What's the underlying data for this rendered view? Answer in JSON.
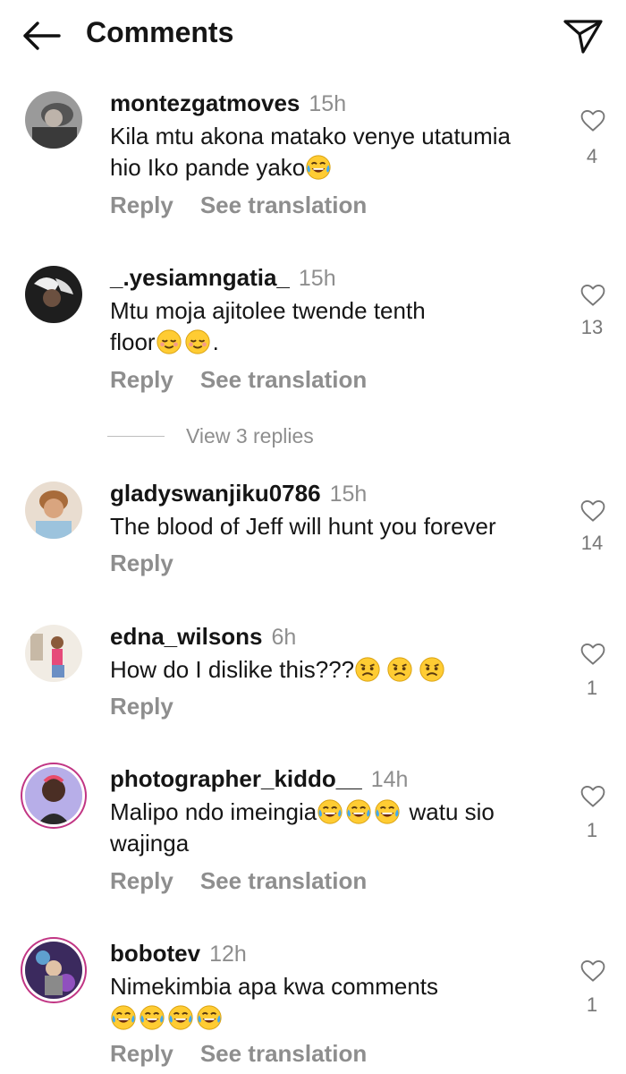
{
  "header": {
    "title": "Comments",
    "back_icon": "arrow-left-icon",
    "send_icon": "paper-plane-icon"
  },
  "actions": {
    "reply": "Reply",
    "see_translation": "See translation"
  },
  "comments": [
    {
      "username": "montezgatmoves",
      "time": "15h",
      "lines": [
        "Kila mtu akona matako venye utatumia",
        "hio Iko pande yako"
      ],
      "emoji": "tears-of-joy",
      "likes": "4",
      "avatar_color": "#6b6b6b"
    },
    {
      "username": "_.yesiamngatia_",
      "time": "15h",
      "lines": [
        "Mtu moja ajitolee twende tenth",
        "floor"
      ],
      "emoji": "relieved",
      "trailing": ".",
      "likes": "13",
      "avatar_color": "#2a2a2a"
    },
    {
      "username": "gladyswanjiku0786",
      "time": "15h",
      "lines": [
        "The blood of Jeff will hunt you forever"
      ],
      "likes": "14",
      "avatar_color": "#c9a887"
    },
    {
      "username": "edna_wilsons",
      "time": "6h",
      "lines": [
        "How do I dislike this???"
      ],
      "emoji": "frowning",
      "likes": "1",
      "avatar_color": "#d8cfc0"
    },
    {
      "username": "photographer_kiddo__",
      "time": "14h",
      "lines": [
        "Malipo ndo imeingia",
        "watu sio",
        "wajinga"
      ],
      "emoji": "tears-of-joy",
      "likes": "1",
      "avatar_color": "#8a7ad0"
    },
    {
      "username": "bobotev",
      "time": "12h",
      "lines": [
        "Nimekimbia apa kwa comments"
      ],
      "emoji": "tears-of-joy",
      "likes": "1",
      "avatar_color": "#5a3c7a"
    }
  ],
  "view_replies": "View 3 replies",
  "colors": {
    "text": "#151515",
    "muted": "#8e8e8e",
    "story_ring": "#c13584",
    "emoji_face": "#ffcc33"
  }
}
